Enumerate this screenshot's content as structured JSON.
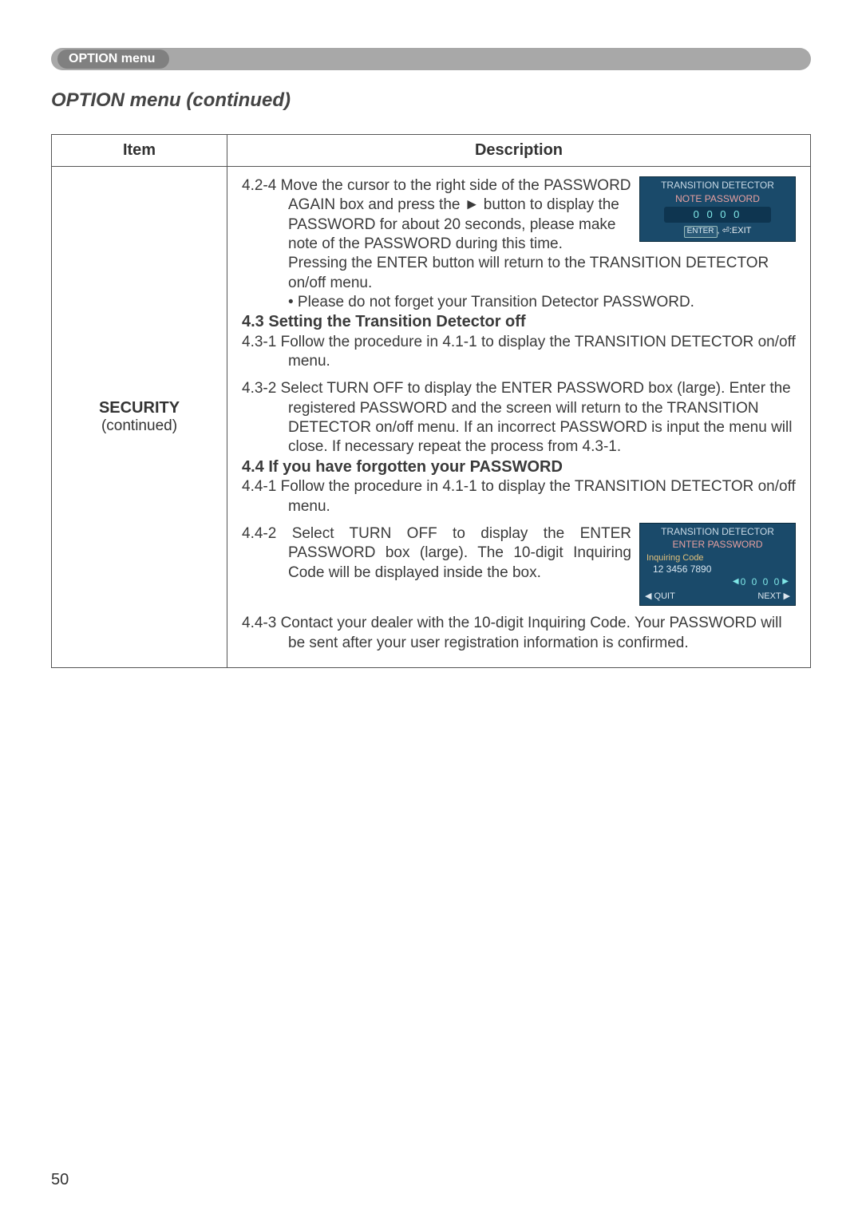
{
  "header": {
    "menu_name": "OPTION menu"
  },
  "section_title": "OPTION menu (continued)",
  "table": {
    "col_item": "Item",
    "col_desc": "Description",
    "item_label": "SECURITY",
    "item_sub": "(continued)"
  },
  "box1": {
    "title": "TRANSITION DETECTOR",
    "sub": "NOTE PASSWORD",
    "code": "0 0 0 0",
    "footer_l": "ENTER",
    "footer_r": ":EXIT"
  },
  "box2": {
    "title": "TRANSITION DETECTOR",
    "sub": "ENTER PASSWORD",
    "inq_label": "Inquiring Code",
    "inq_code": "12 3456 7890",
    "pass": "0 0 0 0",
    "quit": "◀ QUIT",
    "next": "NEXT ▶"
  },
  "steps": {
    "s424_a": "4.2-4 Move the cursor to the right side of the PASSWORD AGAIN box and press the ► button to display the PASSWORD for about 20 seconds, please make note of the PASSWORD during this time.",
    "s424_b": "Pressing the ENTER button will return to the TRANSITION DETECTOR on/off menu.",
    "s424_c": "• Please do not forget your Transition Detector PASSWORD.",
    "h43": "4.3 Setting the Transition Detector off",
    "s431": "4.3-1 Follow the procedure in 4.1-1 to display the TRANSITION DETECTOR on/off menu.",
    "s432": "4.3-2 Select TURN OFF to display the ENTER PASSWORD box (large). Enter the registered PASSWORD and the screen will return to the TRANSITION DETECTOR on/off menu. If an incorrect PASSWORD is input the menu will close. If necessary repeat the process from 4.3-1.",
    "h44": "4.4 If you have forgotten your PASSWORD",
    "s441": "4.4-1 Follow the procedure in 4.1-1 to display the TRANSITION DETECTOR on/off menu.",
    "s442": "4.4-2 Select TURN OFF to display the ENTER PASSWORD box (large). The 10-digit Inquiring Code will be displayed inside the box.",
    "s443": "4.4-3 Contact your dealer with the 10-digit Inquiring Code. Your PASSWORD will be sent after your user registration information is confirmed."
  },
  "page_number": "50"
}
